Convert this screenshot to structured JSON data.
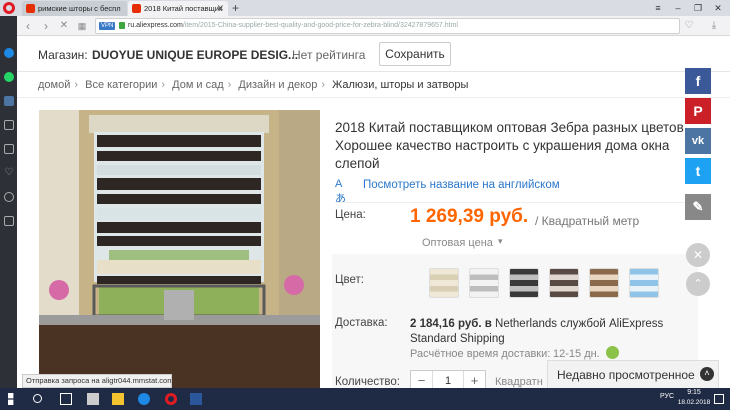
{
  "browser": {
    "tabs": [
      {
        "title": "римские шторы с беспл"
      },
      {
        "title": "2018 Китай поставщик"
      }
    ],
    "url_host": "ru.aliexpress.com",
    "url_path": "/item/2015-China-supplier-best-quality-and-good-price-for-zebra-blind/32427879657.html",
    "vpn_label": "VPN",
    "status_text": "Отправка запроса на aligtr044.mmstat.com..."
  },
  "store": {
    "label": "Магазин:",
    "name": "DUOYUE UNIQUE EUROPE DESIG...",
    "rating": "Нет рейтинга",
    "save_button": "Сохранить"
  },
  "breadcrumb": [
    "домой",
    "Все категории",
    "Дом и сад",
    "Дизайн и декор",
    "Жалюзи, шторы и затворы"
  ],
  "product": {
    "title": "2018 Китай поставщиком оптовая Зебра разных цветов Хорошее качество настроить с украшения дома окна слепой",
    "translate_link": "Посмотреть название на английском",
    "price_label": "Цена:",
    "price": "1 269,39 руб.",
    "price_unit": "/ Квадратный метр",
    "wholesale": "Оптовая цена",
    "color_label": "Цвет:",
    "delivery_label": "Доставка:",
    "delivery_price": "2 184,16 руб.",
    "delivery_in": "в",
    "delivery_dest": "Netherlands службой AliExpress",
    "delivery_service": "Standard Shipping",
    "delivery_time_label": "Расчётное время доставки:",
    "delivery_time": "12-15 дн.",
    "quantity_label": "Количество:",
    "quantity": "1",
    "quantity_minus": "−",
    "quantity_plus": "+",
    "quantity_unit": "Квадратн"
  },
  "recent_bar": "Недавно просмотренное",
  "social": [
    "f",
    "P",
    "vk",
    "t"
  ],
  "taskbar": {
    "time": "9:15",
    "date": "18.02.2018",
    "lang": "РУС"
  },
  "colors": {
    "price": "#ff6600",
    "link": "#2b78c9",
    "facebook": "#3b5998",
    "pinterest": "#cb2027",
    "vk": "#4c75a3",
    "twitter": "#1da1f2"
  }
}
